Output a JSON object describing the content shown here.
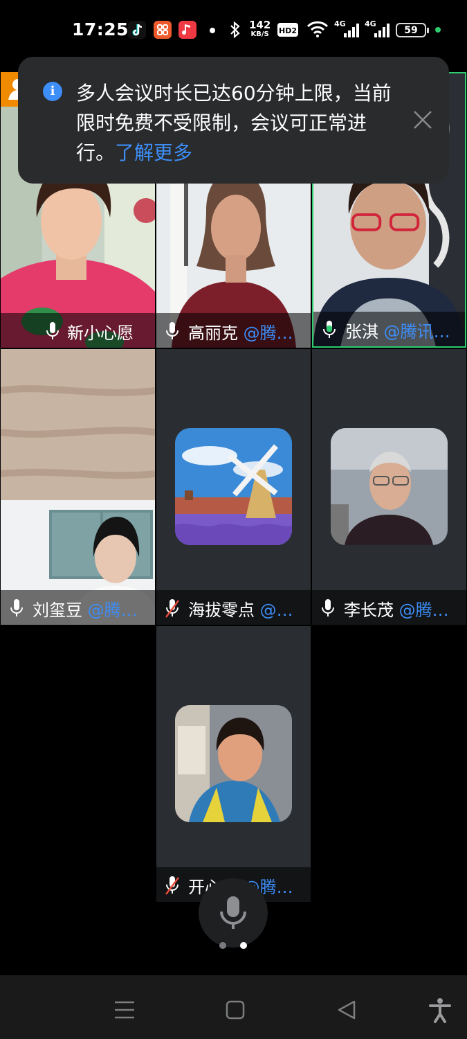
{
  "status_bar": {
    "time": "17:25",
    "net_speed_value": "142",
    "net_speed_unit": "KB/S",
    "hd_badge": "HD2",
    "sim1": "4G",
    "sim2": "4G",
    "battery": "59"
  },
  "notification": {
    "message": "多人会议时长已达60分钟上限，当前限时免费不受限制，会议可正常进行。",
    "link": "了解更多",
    "icon": "info-icon",
    "close_icon": "close-icon"
  },
  "participants": [
    {
      "name": "新小心愿",
      "org": "",
      "mic": "on",
      "host": true,
      "speaking": false
    },
    {
      "name": "高丽克",
      "org": " @腾…",
      "mic": "on",
      "host": false,
      "speaking": false
    },
    {
      "name": "张淇",
      "org": " @腾讯…",
      "mic": "on",
      "host": false,
      "speaking": true
    },
    {
      "name": "刘玺豆",
      "org": " @腾…",
      "mic": "on",
      "host": false,
      "speaking": false
    },
    {
      "name": "海拔零点",
      "org": " @…",
      "mic": "off",
      "host": false,
      "speaking": false
    },
    {
      "name": "李长茂",
      "org": " @腾…",
      "mic": "on",
      "host": false,
      "speaking": false
    },
    {
      "name": "开心果",
      "org": " @腾…",
      "mic": "off",
      "host": false,
      "speaking": false
    }
  ],
  "controls": {
    "floating_mic": "microphone-icon",
    "page_count": 2,
    "current_page": 2
  },
  "colors": {
    "accent": "#3d8ef7",
    "tile_bg": "#2a2d31",
    "speaking": "#2ecc71",
    "host_badge": "#f08a00"
  }
}
